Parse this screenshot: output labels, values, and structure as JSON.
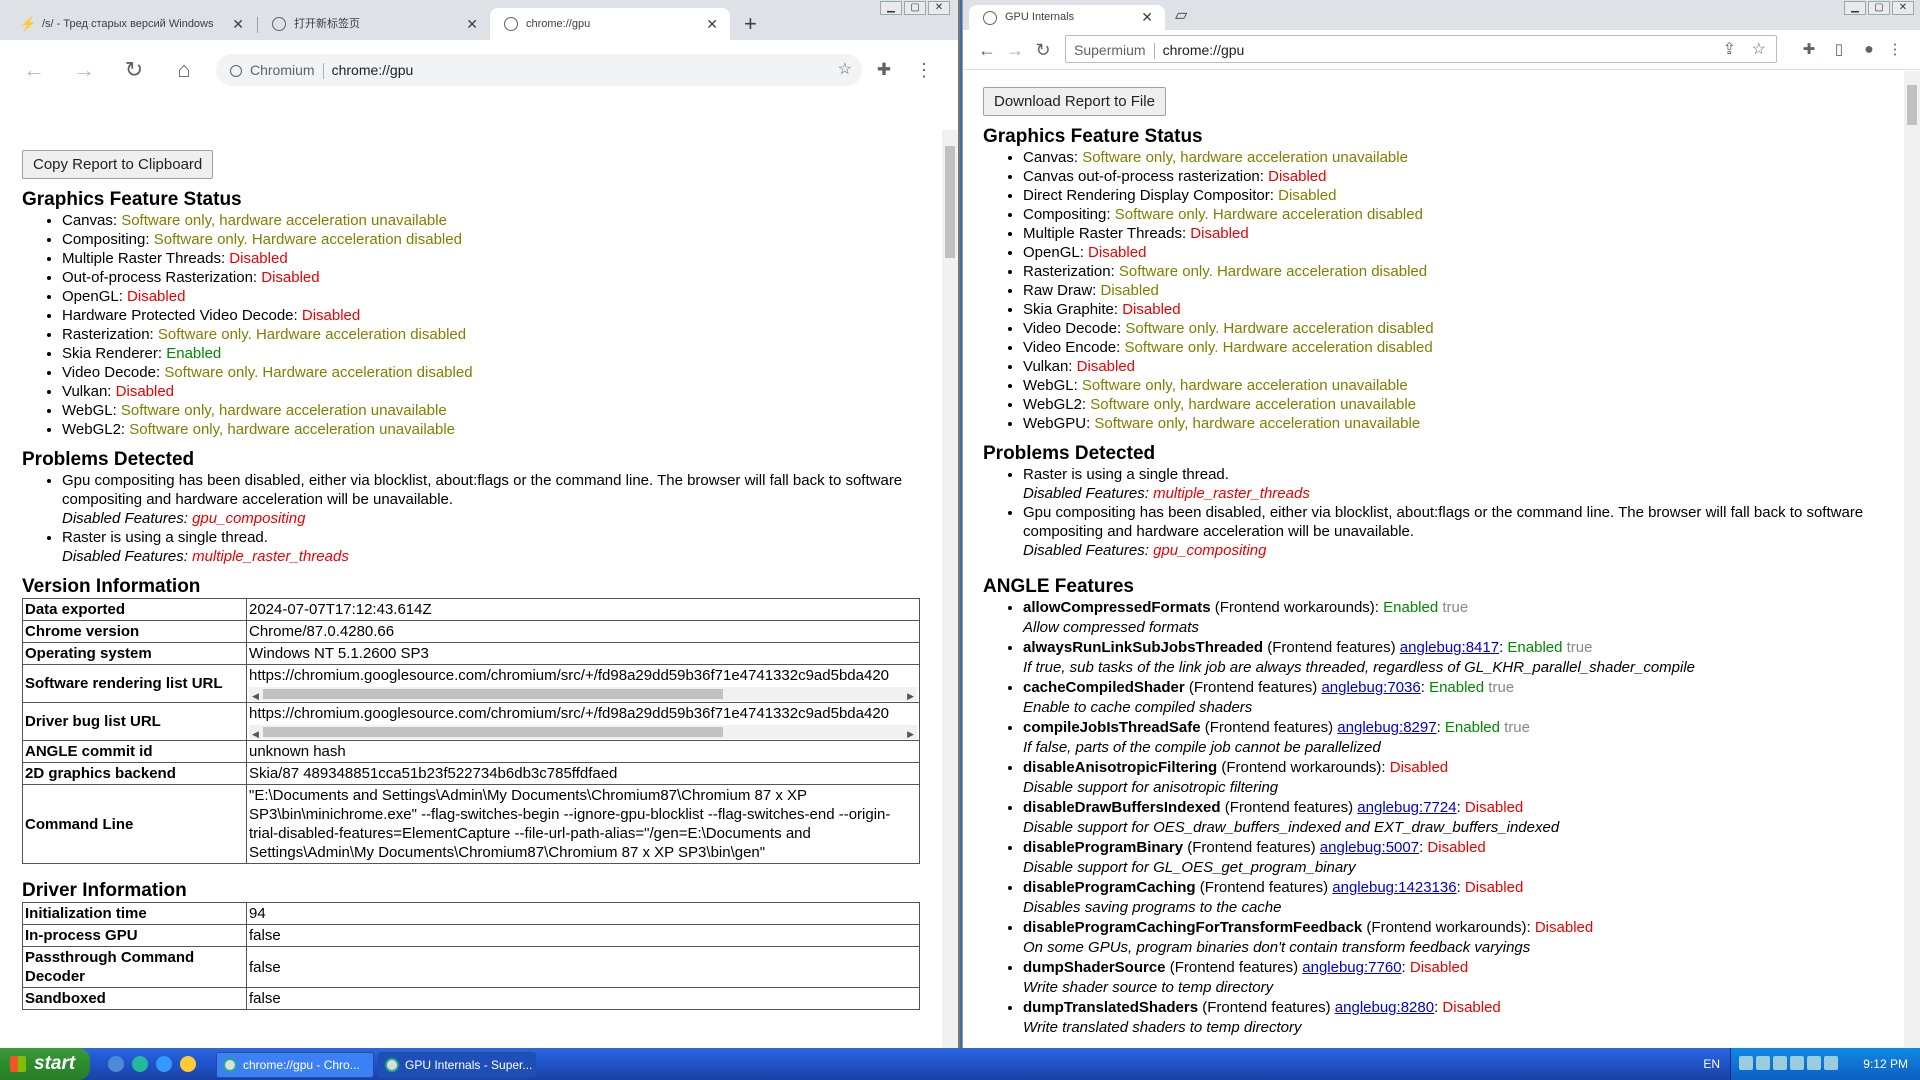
{
  "left": {
    "tabs": [
      {
        "title": "/s/ - Тред старых версий Windows"
      },
      {
        "title": "打开新标签页"
      },
      {
        "title": "chrome://gpu"
      }
    ],
    "omnibox": {
      "origin": "Chromium",
      "url": "chrome://gpu"
    },
    "copy_button": "Copy Report to Clipboard",
    "gfs_title": "Graphics Feature Status",
    "features": [
      {
        "name": "Canvas: ",
        "value": "Software only, hardware acceleration unavailable",
        "status": "sw"
      },
      {
        "name": "Compositing: ",
        "value": "Software only. Hardware acceleration disabled",
        "status": "sw"
      },
      {
        "name": "Multiple Raster Threads: ",
        "value": "Disabled",
        "status": "dis"
      },
      {
        "name": "Out-of-process Rasterization: ",
        "value": "Disabled",
        "status": "dis"
      },
      {
        "name": "OpenGL: ",
        "value": "Disabled",
        "status": "dis"
      },
      {
        "name": "Hardware Protected Video Decode: ",
        "value": "Disabled",
        "status": "dis"
      },
      {
        "name": "Rasterization: ",
        "value": "Software only. Hardware acceleration disabled",
        "status": "sw"
      },
      {
        "name": "Skia Renderer: ",
        "value": "Enabled",
        "status": "en"
      },
      {
        "name": "Video Decode: ",
        "value": "Software only. Hardware acceleration disabled",
        "status": "sw"
      },
      {
        "name": "Vulkan: ",
        "value": "Disabled",
        "status": "dis"
      },
      {
        "name": "WebGL: ",
        "value": "Software only, hardware acceleration unavailable",
        "status": "sw"
      },
      {
        "name": "WebGL2: ",
        "value": "Software only, hardware acceleration unavailable",
        "status": "sw"
      }
    ],
    "problems_title": "Problems Detected",
    "problems": [
      {
        "text": "Gpu compositing has been disabled, either via blocklist, about:flags or the command line. The browser will fall back to software compositing and hardware acceleration will be unavailable.",
        "label": "Disabled Features: ",
        "feature": "gpu_compositing"
      },
      {
        "text": "Raster is using a single thread.",
        "label": "Disabled Features: ",
        "feature": "multiple_raster_threads"
      }
    ],
    "version_title": "Version Information",
    "version_rows": [
      {
        "k": "Data exported",
        "v": "2024-07-07T17:12:43.614Z"
      },
      {
        "k": "Chrome version",
        "v": "Chrome/87.0.4280.66"
      },
      {
        "k": "Operating system",
        "v": "Windows NT 5.1.2600 SP3"
      },
      {
        "k": "Software rendering list URL",
        "v": "https://chromium.googlesource.com/chromium/src/+/fd98a29dd59b36f71e4741332c9ad5bda420",
        "scroll": true
      },
      {
        "k": "Driver bug list URL",
        "v": "https://chromium.googlesource.com/chromium/src/+/fd98a29dd59b36f71e4741332c9ad5bda420",
        "scroll": true
      },
      {
        "k": "ANGLE commit id",
        "v": "unknown hash"
      },
      {
        "k": "2D graphics backend",
        "v": "Skia/87 489348851cca51b23f522734b6db3c785ffdfaed"
      },
      {
        "k": "Command Line",
        "v": "\"E:\\Documents and Settings\\Admin\\My Documents\\Chromium87\\Chromium 87 x XP SP3\\bin\\minichrome.exe\" --flag-switches-begin --ignore-gpu-blocklist --flag-switches-end --origin-trial-disabled-features=ElementCapture --file-url-path-alias=\"/gen=E:\\Documents and Settings\\Admin\\My Documents\\Chromium87\\Chromium 87 x XP SP3\\bin\\gen\"",
        "wrap": true
      }
    ],
    "driver_title": "Driver Information",
    "driver_rows": [
      {
        "k": "Initialization time",
        "v": "94"
      },
      {
        "k": "In-process GPU",
        "v": "false"
      },
      {
        "k": "Passthrough Command Decoder",
        "v": "false"
      },
      {
        "k": "Sandboxed",
        "v": "false"
      }
    ]
  },
  "right": {
    "tab_title": "GPU Internals",
    "omnibox": {
      "origin": "Supermium",
      "url": "chrome://gpu"
    },
    "download_button": "Download Report to File",
    "gfs_title": "Graphics Feature Status",
    "features": [
      {
        "name": "Canvas: ",
        "value": "Software only, hardware acceleration unavailable",
        "status": "sw"
      },
      {
        "name": "Canvas out-of-process rasterization: ",
        "value": "Disabled",
        "status": "dis"
      },
      {
        "name": "Direct Rendering Display Compositor: ",
        "value": "Disabled",
        "status": "sw"
      },
      {
        "name": "Compositing: ",
        "value": "Software only. Hardware acceleration disabled",
        "status": "sw"
      },
      {
        "name": "Multiple Raster Threads: ",
        "value": "Disabled",
        "status": "dis"
      },
      {
        "name": "OpenGL: ",
        "value": "Disabled",
        "status": "dis"
      },
      {
        "name": "Rasterization: ",
        "value": "Software only. Hardware acceleration disabled",
        "status": "sw"
      },
      {
        "name": "Raw Draw: ",
        "value": "Disabled",
        "status": "sw"
      },
      {
        "name": "Skia Graphite: ",
        "value": "Disabled",
        "status": "dis"
      },
      {
        "name": "Video Decode: ",
        "value": "Software only. Hardware acceleration disabled",
        "status": "sw"
      },
      {
        "name": "Video Encode: ",
        "value": "Software only. Hardware acceleration disabled",
        "status": "sw"
      },
      {
        "name": "Vulkan: ",
        "value": "Disabled",
        "status": "dis"
      },
      {
        "name": "WebGL: ",
        "value": "Software only, hardware acceleration unavailable",
        "status": "sw"
      },
      {
        "name": "WebGL2: ",
        "value": "Software only, hardware acceleration unavailable",
        "status": "sw"
      },
      {
        "name": "WebGPU: ",
        "value": "Software only, hardware acceleration unavailable",
        "status": "sw"
      }
    ],
    "problems_title": "Problems Detected",
    "problems": [
      {
        "text": "Raster is using a single thread.",
        "label": "Disabled Features: ",
        "feature": "multiple_raster_threads"
      },
      {
        "text": "Gpu compositing has been disabled, either via blocklist, about:flags or the command line. The browser will fall back to software compositing and hardware acceleration will be unavailable.",
        "label": "Disabled Features: ",
        "feature": "gpu_compositing"
      }
    ],
    "angle_title": "ANGLE Features",
    "angle": [
      {
        "name": "allowCompressedFormats",
        "cat": " (Frontend workarounds): ",
        "bug": "",
        "state": "Enabled",
        "val": " true",
        "desc": "Allow compressed formats"
      },
      {
        "name": "alwaysRunLinkSubJobsThreaded",
        "cat": " (Frontend features) ",
        "bug": "anglebug:8417",
        "state": "Enabled",
        "val": " true",
        "desc": "If true, sub tasks of the link job are always threaded, regardless of GL_KHR_parallel_shader_compile"
      },
      {
        "name": "cacheCompiledShader",
        "cat": " (Frontend features) ",
        "bug": "anglebug:7036",
        "state": "Enabled",
        "val": " true",
        "desc": "Enable to cache compiled shaders"
      },
      {
        "name": "compileJobIsThreadSafe",
        "cat": " (Frontend features) ",
        "bug": "anglebug:8297",
        "state": "Enabled",
        "val": " true",
        "desc": "If false, parts of the compile job cannot be parallelized"
      },
      {
        "name": "disableAnisotropicFiltering",
        "cat": " (Frontend workarounds): ",
        "bug": "",
        "state": "Disabled",
        "val": "",
        "desc": "Disable support for anisotropic filtering"
      },
      {
        "name": "disableDrawBuffersIndexed",
        "cat": " (Frontend features) ",
        "bug": "anglebug:7724",
        "state": "Disabled",
        "val": "",
        "desc": "Disable support for OES_draw_buffers_indexed and EXT_draw_buffers_indexed"
      },
      {
        "name": "disableProgramBinary",
        "cat": " (Frontend features) ",
        "bug": "anglebug:5007",
        "state": "Disabled",
        "val": "",
        "desc": "Disable support for GL_OES_get_program_binary"
      },
      {
        "name": "disableProgramCaching",
        "cat": " (Frontend features) ",
        "bug": "anglebug:1423136",
        "state": "Disabled",
        "val": "",
        "desc": "Disables saving programs to the cache"
      },
      {
        "name": "disableProgramCachingForTransformFeedback",
        "cat": " (Frontend workarounds): ",
        "bug": "",
        "state": "Disabled",
        "val": "",
        "desc": "On some GPUs, program binaries don't contain transform feedback varyings"
      },
      {
        "name": "dumpShaderSource",
        "cat": " (Frontend features) ",
        "bug": "anglebug:7760",
        "state": "Disabled",
        "val": "",
        "desc": "Write shader source to temp directory"
      },
      {
        "name": "dumpTranslatedShaders",
        "cat": " (Frontend features) ",
        "bug": "anglebug:8280",
        "state": "Disabled",
        "val": "",
        "desc": "Write translated shaders to temp directory"
      }
    ]
  },
  "taskbar": {
    "start": "start",
    "tasks": [
      {
        "title": "chrome://gpu - Chro..."
      },
      {
        "title": "GPU Internals - Super..."
      }
    ],
    "lang": "EN",
    "clock": "9:12 PM"
  },
  "colors": {
    "software": "#808000",
    "disabled": "#e00000",
    "enabled": "#008000",
    "desktop": "#3a6ea5"
  }
}
